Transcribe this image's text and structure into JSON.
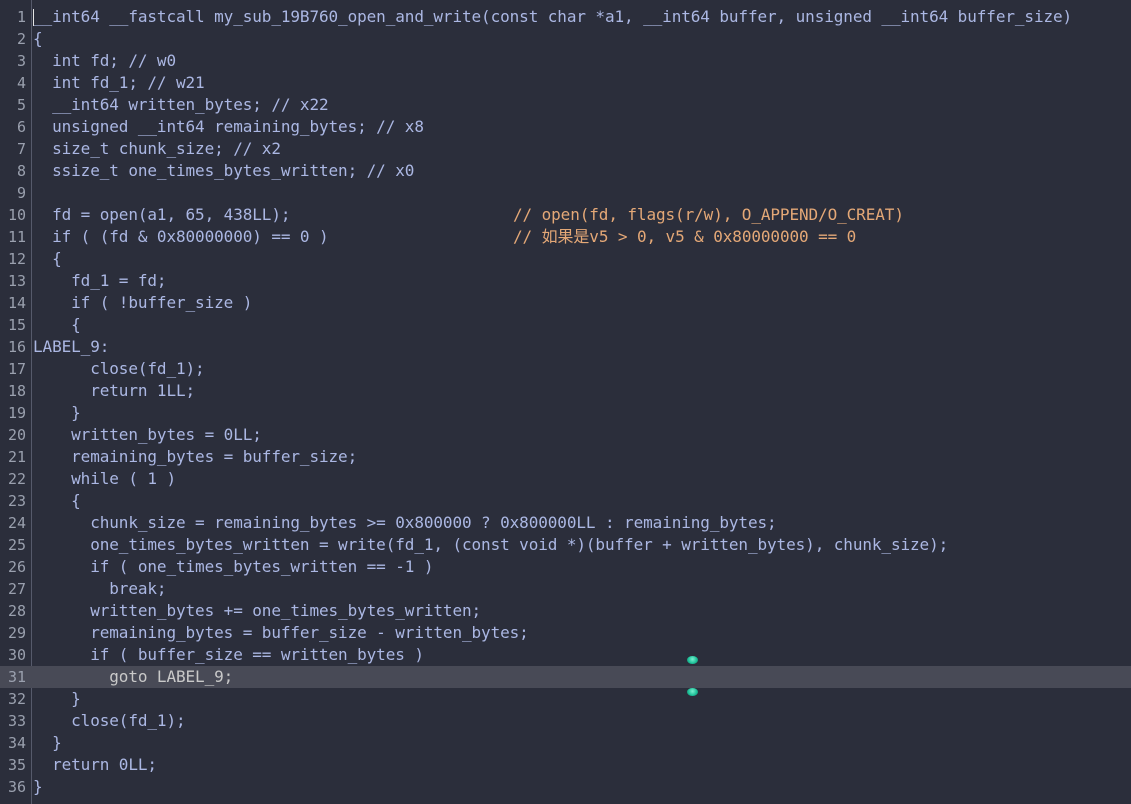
{
  "editor": {
    "current_line": 31,
    "lines": [
      {
        "n": "1",
        "text": "__int64 __fastcall my_sub_19B760_open_and_write(const char *a1, __int64 buffer, unsigned __int64 buffer_size)"
      },
      {
        "n": "2",
        "text": "{"
      },
      {
        "n": "3",
        "text": "  int fd; // w0"
      },
      {
        "n": "4",
        "text": "  int fd_1; // w21"
      },
      {
        "n": "5",
        "text": "  __int64 written_bytes; // x22"
      },
      {
        "n": "6",
        "text": "  unsigned __int64 remaining_bytes; // x8"
      },
      {
        "n": "7",
        "text": "  size_t chunk_size; // x2"
      },
      {
        "n": "8",
        "text": "  ssize_t one_times_bytes_written; // x0"
      },
      {
        "n": "9",
        "text": ""
      },
      {
        "n": "10",
        "text": "  fd = open(a1, 65, 438LL);",
        "comment": "// open(fd, flags(r/w), O_APPEND/O_CREAT)"
      },
      {
        "n": "11",
        "text": "  if ( (fd & 0x80000000) == 0 )",
        "comment": "// 如果是v5 > 0, v5 & 0x80000000 == 0"
      },
      {
        "n": "12",
        "text": "  {"
      },
      {
        "n": "13",
        "text": "    fd_1 = fd;"
      },
      {
        "n": "14",
        "text": "    if ( !buffer_size )"
      },
      {
        "n": "15",
        "text": "    {"
      },
      {
        "n": "16",
        "text": "LABEL_9:"
      },
      {
        "n": "17",
        "text": "      close(fd_1);"
      },
      {
        "n": "18",
        "text": "      return 1LL;"
      },
      {
        "n": "19",
        "text": "    }"
      },
      {
        "n": "20",
        "text": "    written_bytes = 0LL;"
      },
      {
        "n": "21",
        "text": "    remaining_bytes = buffer_size;"
      },
      {
        "n": "22",
        "text": "    while ( 1 )"
      },
      {
        "n": "23",
        "text": "    {"
      },
      {
        "n": "24",
        "text": "      chunk_size = remaining_bytes >= 0x800000 ? 0x800000LL : remaining_bytes;"
      },
      {
        "n": "25",
        "text": "      one_times_bytes_written = write(fd_1, (const void *)(buffer + written_bytes), chunk_size);"
      },
      {
        "n": "26",
        "text": "      if ( one_times_bytes_written == -1 )"
      },
      {
        "n": "27",
        "text": "        break;"
      },
      {
        "n": "28",
        "text": "      written_bytes += one_times_bytes_written;"
      },
      {
        "n": "29",
        "text": "      remaining_bytes = buffer_size - written_bytes;"
      },
      {
        "n": "30",
        "text": "      if ( buffer_size == written_bytes )"
      },
      {
        "n": "31",
        "text": "        goto LABEL_9;"
      },
      {
        "n": "32",
        "text": "    }"
      },
      {
        "n": "33",
        "text": "    close(fd_1);"
      },
      {
        "n": "34",
        "text": "  }"
      },
      {
        "n": "35",
        "text": "  return 0LL;"
      },
      {
        "n": "36",
        "text": "}"
      }
    ]
  },
  "colors": {
    "background": "#2b2e3b",
    "code_text": "#abb7e3",
    "comment_text": "#e4a877",
    "line_number": "#9aa0ae",
    "current_line_bg": "#484a56",
    "marker": "#1fc29a"
  },
  "markers": [
    "branch-marker-top",
    "branch-marker-bottom"
  ]
}
